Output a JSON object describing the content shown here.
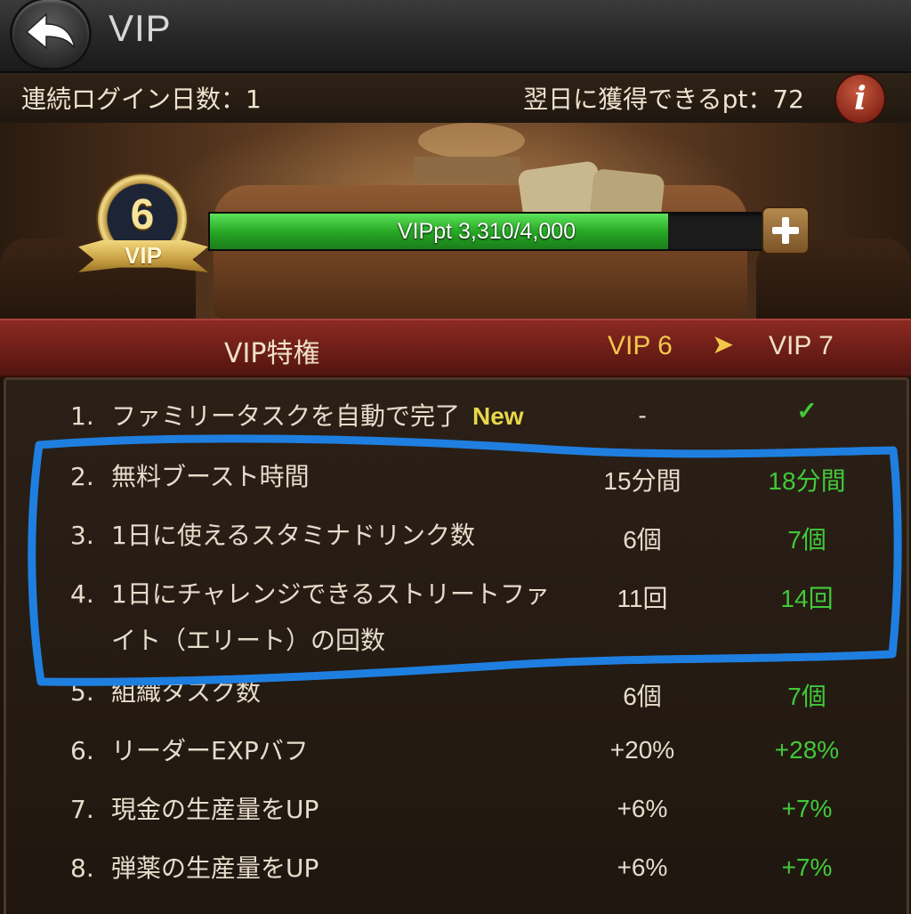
{
  "header": {
    "title": "VIP",
    "back_icon": "back-arrow-icon"
  },
  "info": {
    "login_days": "連続ログイン日数：1",
    "next_day_pt": "翌日に獲得できるpt：72",
    "info_icon": "info-icon",
    "info_glyph": "i"
  },
  "vip": {
    "level": "6",
    "badge_label": "VIP",
    "progress_label": "VIPpt 3,310/4,000",
    "progress_value": 3310,
    "progress_max": 4000,
    "plus_icon": "plus-icon"
  },
  "table": {
    "header_label": "VIP特権",
    "current_level": "VIP 6",
    "arrow": "➤",
    "next_level": "VIP 7",
    "rows": [
      {
        "num": "1.",
        "name": "ファミリータスクを自動で完了",
        "badge": "New",
        "current": "-",
        "next": "✓"
      },
      {
        "num": "2.",
        "name": "無料ブースト時間",
        "current": "15分間",
        "next": "18分間"
      },
      {
        "num": "3.",
        "name": "1日に使えるスタミナドリンク数",
        "current": "6個",
        "next": "7個"
      },
      {
        "num": "4.",
        "name": "1日にチャレンジできるストリートファイト（エリート）の回数",
        "current": "11回",
        "next": "14回"
      },
      {
        "num": "5.",
        "name": "組織タスク数",
        "current": "6個",
        "next": "7個"
      },
      {
        "num": "6.",
        "name": "リーダーEXPバフ",
        "current": "+20%",
        "next": "+28%"
      },
      {
        "num": "7.",
        "name": "現金の生産量をUP",
        "current": "+6%",
        "next": "+7%"
      },
      {
        "num": "8.",
        "name": "弾薬の生産量をUP",
        "current": "+6%",
        "next": "+7%"
      }
    ]
  },
  "colors": {
    "accent_gold": "#f3c74a",
    "green": "#41c93a",
    "header_red": "#6a1c16",
    "highlight_blue": "#1f7fe0"
  }
}
